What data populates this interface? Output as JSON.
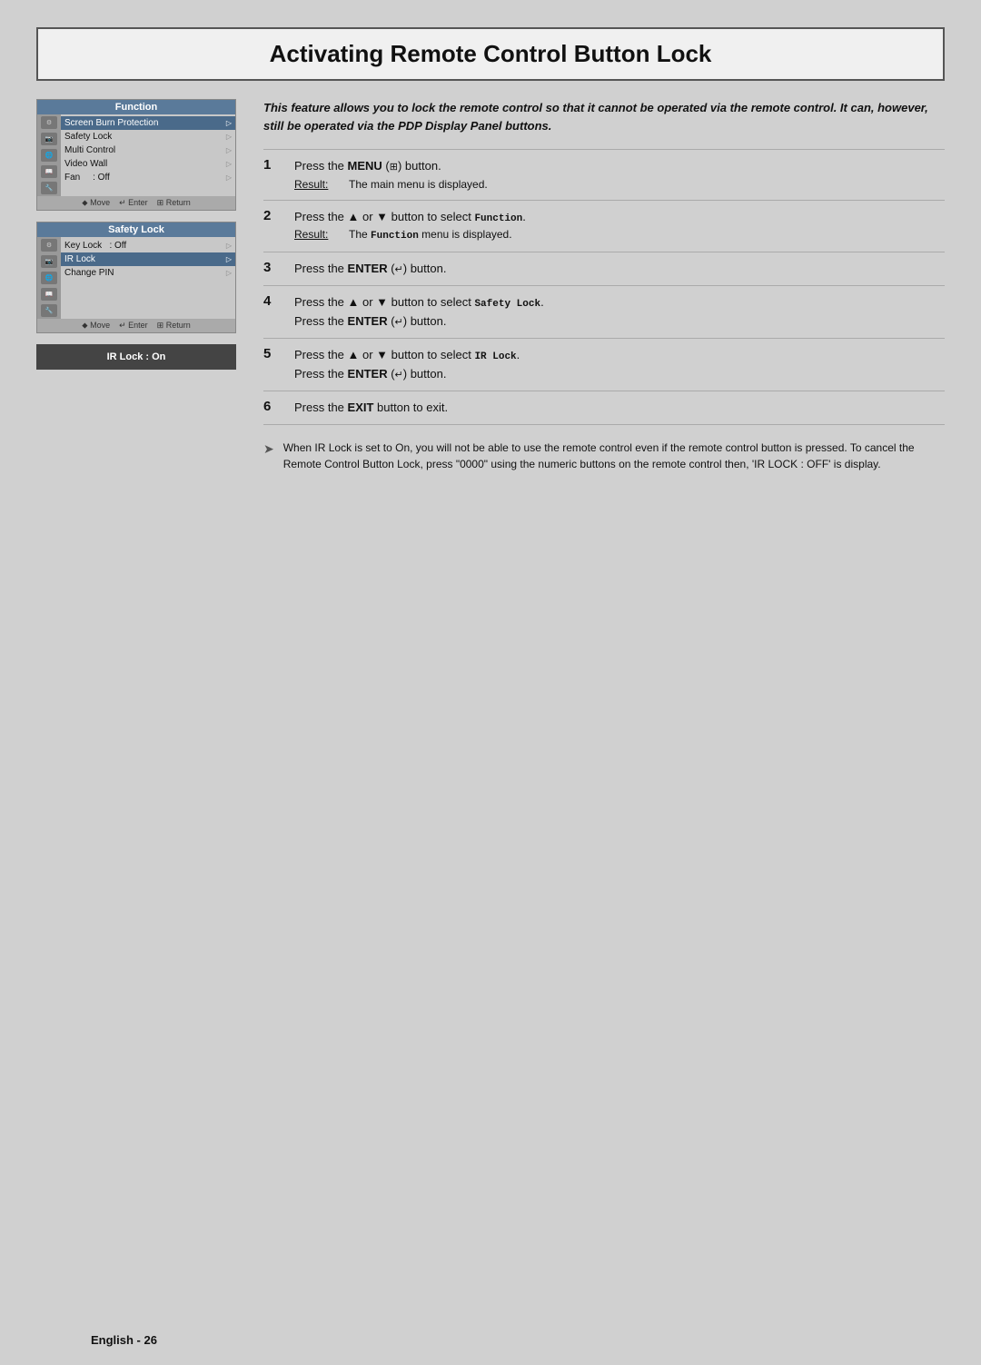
{
  "page": {
    "title": "Activating Remote Control Button Lock",
    "background_color": "#d0d0d0"
  },
  "intro": {
    "text": "This feature allows you to lock the remote control so that it cannot be operated via the remote control. It can, however, still be operated via the PDP Display Panel buttons."
  },
  "menu1": {
    "title": "Function",
    "items": [
      {
        "label": "Screen Burn Protection",
        "has_arrow": true,
        "selected": true
      },
      {
        "label": "Safety Lock",
        "has_arrow": true
      },
      {
        "label": "Multi Control",
        "has_arrow": true
      },
      {
        "label": "Video Wall",
        "has_arrow": true
      },
      {
        "label": "Fan",
        "value": ": Off",
        "has_arrow": true
      }
    ],
    "footer": [
      "⬥ Move",
      "↵ Enter",
      "⊞ Return"
    ]
  },
  "menu2": {
    "title": "Safety Lock",
    "items": [
      {
        "label": "Key Lock",
        "value": ": Off",
        "has_arrow": true
      },
      {
        "label": "IR Lock",
        "has_arrow": true,
        "selected": true
      },
      {
        "label": "Change PIN",
        "has_arrow": true
      }
    ],
    "footer": [
      "⬥ Move",
      "↵ Enter",
      "⊞ Return"
    ]
  },
  "ir_lock_box": {
    "label": "IR Lock : On"
  },
  "steps": [
    {
      "num": "1",
      "instruction": "Press the MENU (⊞) button.",
      "result_label": "Result:",
      "result_text": "The main menu is displayed."
    },
    {
      "num": "2",
      "instruction": "Press the ▲ or ▼ button to select Function.",
      "result_label": "Result:",
      "result_text": "The Function menu is displayed."
    },
    {
      "num": "3",
      "instruction": "Press the ENTER (↵) button.",
      "result_label": "",
      "result_text": ""
    },
    {
      "num": "4",
      "instruction": "Press the ▲ or ▼ button to select Safety Lock.",
      "instruction2": "Press the ENTER (↵) button.",
      "result_label": "",
      "result_text": ""
    },
    {
      "num": "5",
      "instruction": "Press the ▲ or ▼ button to select IR Lock.",
      "instruction2": "Press the ENTER (↵) button.",
      "result_label": "",
      "result_text": ""
    },
    {
      "num": "6",
      "instruction": "Press the EXIT button to exit.",
      "result_label": "",
      "result_text": ""
    }
  ],
  "note": {
    "arrow": "➤",
    "text": "When IR Lock is set to On, you will not be able to use the remote control even if the remote control button is pressed. To cancel the Remote Control Button Lock, press \"0000\" using the numeric buttons on the remote control then, 'IR LOCK : OFF' is display."
  },
  "footer": {
    "text": "English - 26"
  },
  "icons": [
    "settings-icon",
    "camera-icon",
    "globe-icon",
    "book-icon",
    "wrench-icon"
  ]
}
